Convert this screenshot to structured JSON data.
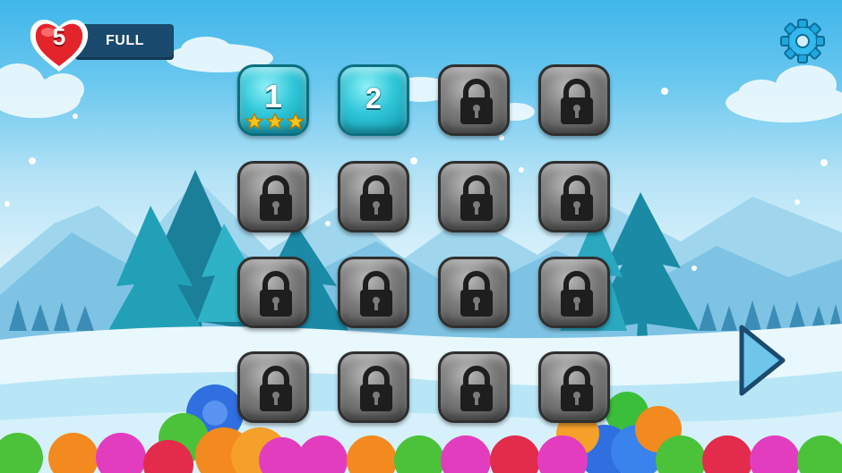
{
  "hud": {
    "lives": "5",
    "lives_status": "FULL",
    "icons": {
      "heart": "heart-icon",
      "settings": "gear-icon",
      "next": "play-arrow-icon"
    }
  },
  "colors": {
    "unlocked": "#2fc6d8",
    "locked": "#7b7b7b",
    "heart": "#e3252b",
    "star": "#f7c21b"
  },
  "levels": [
    {
      "number": "1",
      "locked": false,
      "stars": 3
    },
    {
      "number": "2",
      "locked": false,
      "stars": 0
    },
    {
      "locked": true
    },
    {
      "locked": true
    },
    {
      "locked": true
    },
    {
      "locked": true
    },
    {
      "locked": true
    },
    {
      "locked": true
    },
    {
      "locked": true
    },
    {
      "locked": true
    },
    {
      "locked": true
    },
    {
      "locked": true
    },
    {
      "locked": true
    },
    {
      "locked": true
    },
    {
      "locked": true
    },
    {
      "locked": true
    }
  ]
}
